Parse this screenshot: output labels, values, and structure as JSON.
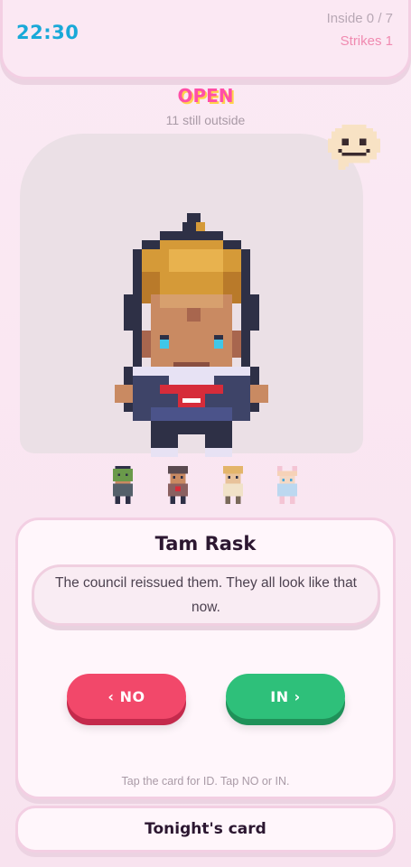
{
  "header": {
    "clock": "22:30",
    "inside_label": "Inside 0 / 7",
    "strikes_label": "Strikes 1",
    "inside_count": 0,
    "inside_capacity": 7,
    "strikes": 1
  },
  "door": {
    "status": "OPEN",
    "outside_label": "11 still outside",
    "outside_count": 11
  },
  "mood_icon": "uneasy-face-speech-bubble-icon",
  "current_guest": {
    "portrait_icon": "pixel-guest-portrait-blond-navy-uniform"
  },
  "queue": [
    {
      "icon": "green-mask-guest-icon"
    },
    {
      "icon": "capped-guest-icon"
    },
    {
      "icon": "blond-guest-icon"
    },
    {
      "icon": "bunny-ears-guest-icon"
    }
  ],
  "card": {
    "name": "Tam Rask",
    "quote": "The council reissued them. They all look like that now.",
    "no_label": "‹ NO",
    "in_label": "IN ›",
    "hint": "Tap the card for ID. Tap NO or IN."
  },
  "footer": {
    "tonight_label": "Tonight's card"
  },
  "colors": {
    "background": "#fbeaf4",
    "clock": "#19a9d8",
    "status": "#ff4fa7",
    "status_shadow": "#ffd24a",
    "strikes": "#f08ab0",
    "no_button": "#f2486a",
    "in_button": "#2ec07a",
    "title_text": "#2c1731"
  }
}
